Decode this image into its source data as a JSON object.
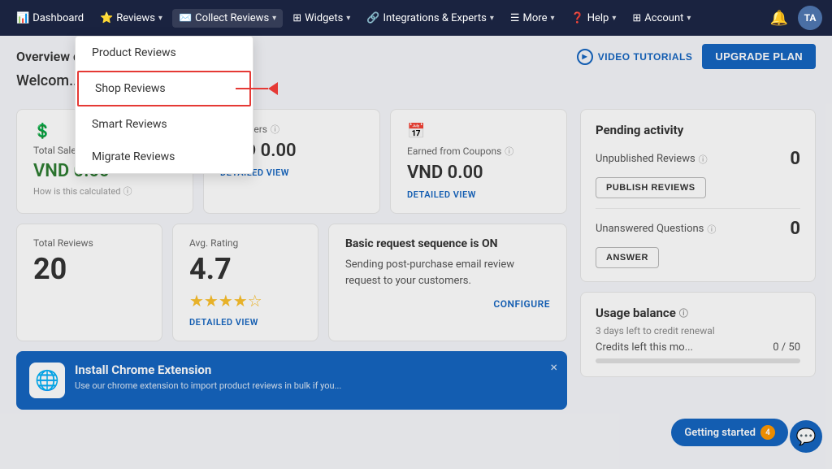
{
  "navbar": {
    "items": [
      {
        "label": "Dashboard",
        "icon": "📊",
        "hasDropdown": false,
        "name": "dashboard"
      },
      {
        "label": "Reviews",
        "icon": "⭐",
        "hasDropdown": true,
        "name": "reviews"
      },
      {
        "label": "Collect Reviews",
        "icon": "✉️",
        "hasDropdown": true,
        "name": "collect-reviews"
      },
      {
        "label": "Widgets",
        "icon": "⊞",
        "hasDropdown": true,
        "name": "widgets"
      },
      {
        "label": "Integrations & Experts",
        "icon": "🔗",
        "hasDropdown": true,
        "name": "integrations"
      },
      {
        "label": "More",
        "icon": "☰",
        "hasDropdown": true,
        "name": "more"
      },
      {
        "label": "Help",
        "icon": "❓",
        "hasDropdown": true,
        "name": "help"
      },
      {
        "label": "Account",
        "icon": "⊞",
        "hasDropdown": true,
        "name": "account"
      }
    ],
    "avatar_text": "TA"
  },
  "dropdown": {
    "items": [
      {
        "label": "Product Reviews",
        "highlighted": false,
        "name": "product-reviews"
      },
      {
        "label": "Shop Reviews",
        "highlighted": true,
        "name": "shop-reviews"
      },
      {
        "label": "Smart Reviews",
        "highlighted": false,
        "name": "smart-reviews"
      },
      {
        "label": "Migrate Reviews",
        "highlighted": false,
        "name": "migrate-reviews"
      }
    ]
  },
  "header": {
    "page_title": "Overview da...",
    "video_btn": "VIDEO TUTORIALS",
    "upgrade_btn": "UPGRADE PLAN",
    "welcome": "Welcom..."
  },
  "stats": {
    "total_sales_label": "Total Sales Revenue",
    "total_sales_value": "VND 0.00",
    "how_calculated": "How is this calculated",
    "orders_label": "ced Orders",
    "orders_value": "VND 0.00",
    "orders_detailed": "DETAILED VIEW",
    "coupons_label": "Earned from Coupons",
    "coupons_value": "VND 0.00",
    "coupons_detailed": "DETAILED VIEW"
  },
  "reviews_section": {
    "total_label": "Total Reviews",
    "total_value": "20",
    "avg_label": "Avg. Rating",
    "avg_value": "4.7",
    "stars": "★★★★☆",
    "detailed_link": "DETAILED VIEW"
  },
  "request_section": {
    "title": "Basic request sequence is ON",
    "desc": "Sending post-purchase email review request to your customers.",
    "configure_link": "CONFIGURE"
  },
  "pending_activity": {
    "title": "Pending activity",
    "unpublished_label": "Unpublished Reviews",
    "unpublished_count": "0",
    "publish_btn": "PUBLISH REVIEWS",
    "unanswered_label": "Unanswered Questions",
    "unanswered_count": "0",
    "answer_btn": "ANSWER"
  },
  "usage_balance": {
    "title": "Usage balance",
    "hint": "3 days left to credit renewal",
    "credits_label": "Credits left this mo...",
    "credits_value": "0 / 50"
  },
  "chrome_banner": {
    "title": "Install Chrome Extension",
    "desc": "Use our chrome extension to import product reviews in bulk if you...",
    "close_label": "×"
  },
  "getting_started": {
    "label": "Getting started",
    "badge": "4"
  }
}
